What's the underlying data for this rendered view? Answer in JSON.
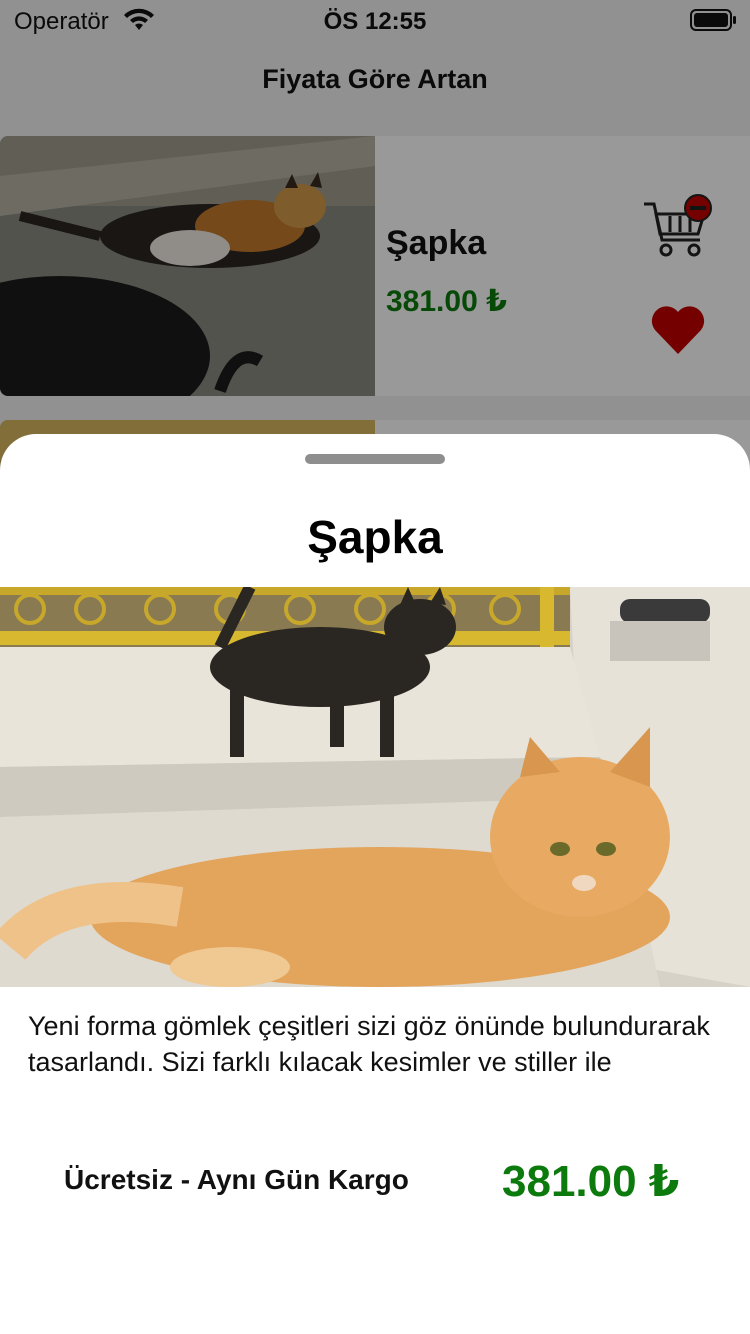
{
  "status_bar": {
    "carrier": "Operatör",
    "time": "ÖS 12:55",
    "wifi_icon": "wifi-icon",
    "battery_icon": "battery-icon"
  },
  "nav": {
    "title": "Fiyata Göre Artan"
  },
  "product_list": [
    {
      "name": "Şapka",
      "price": "381.00 ₺",
      "image": "calico-cat-photo",
      "cart_icon": "remove-from-cart-icon",
      "favorite_icon": "heart-filled-icon"
    },
    {
      "image": "cat-photo"
    }
  ],
  "detail_sheet": {
    "title": "Şapka",
    "image": "cats-on-steps-photo",
    "description": "Yeni forma gömlek çeşitleri sizi göz önünde bulundurarak tasarlandı. Sizi farklı kılacak kesimler ve stiller ile",
    "shipping": "Ücretsiz - Aynı Gün Kargo",
    "price": "381.00 ₺"
  },
  "colors": {
    "price_green": "#0c7a0c",
    "heart_red": "#c40000",
    "cart_badge_red": "#c40000"
  }
}
